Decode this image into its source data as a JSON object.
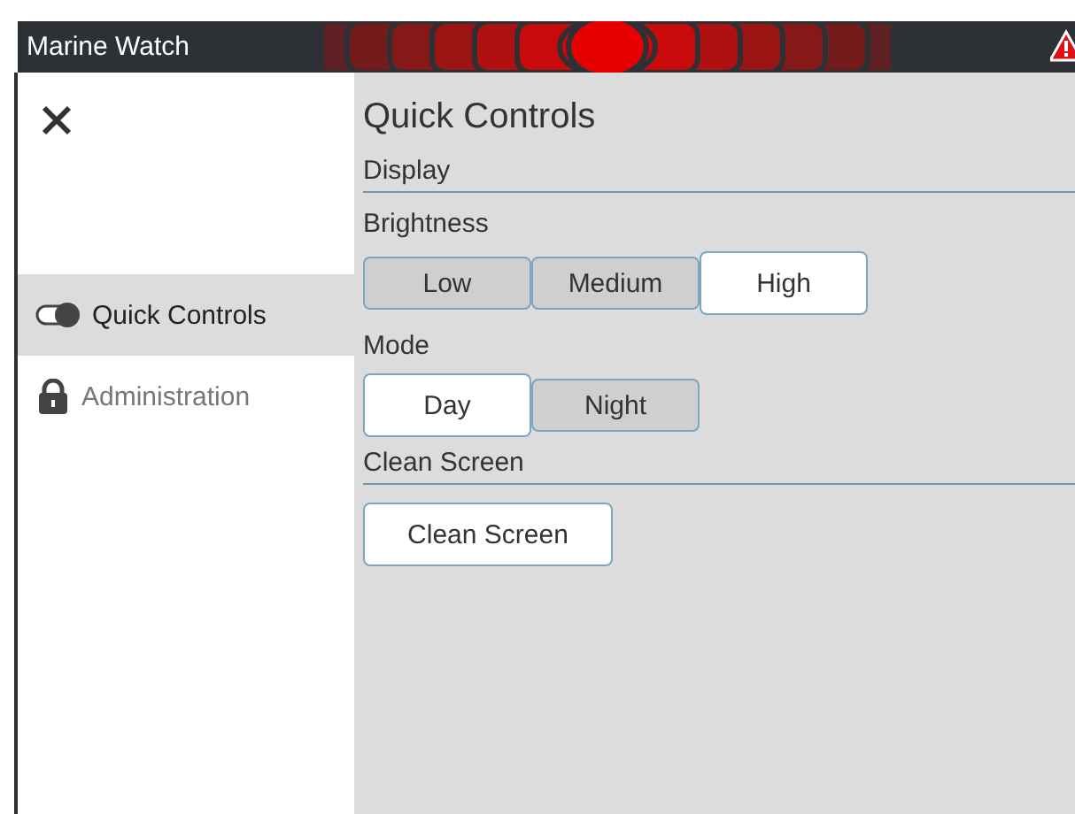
{
  "window": {
    "title": "Marine Watch"
  },
  "sidebar": {
    "items": [
      {
        "label": "Quick Controls",
        "kind": "toggle",
        "selected": true
      },
      {
        "label": "Administration",
        "kind": "lock",
        "selected": false
      }
    ]
  },
  "main": {
    "title": "Quick Controls",
    "section": "Display",
    "groups": [
      {
        "kind": "segmented",
        "label": "Brightness",
        "options": [
          {
            "label": "Low",
            "selected": false
          },
          {
            "label": "Medium",
            "selected": false
          },
          {
            "label": "High",
            "selected": true
          }
        ]
      },
      {
        "kind": "segmented",
        "label": "Mode",
        "options": [
          {
            "label": "Day",
            "selected": true
          },
          {
            "label": "Night",
            "selected": false
          }
        ]
      },
      {
        "kind": "action",
        "label": "Clean Screen",
        "button": "Clean Screen"
      }
    ]
  }
}
